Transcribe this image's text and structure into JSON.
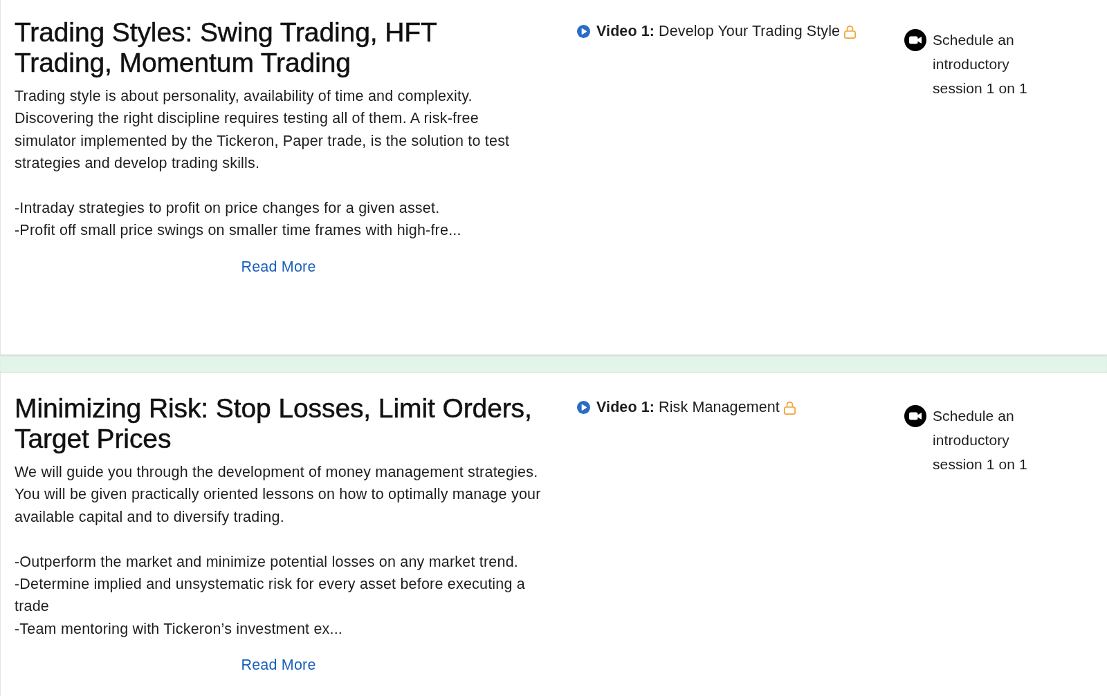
{
  "courses": [
    {
      "title": "Trading Styles: Swing Trading, HFT Trading, Momentum Trading",
      "description": "Trading style is about personality, availability of time and complexity. Discovering the right discipline requires testing all of them. A risk-free simulator implemented by the Tickeron, Paper trade, is the solution to test strategies and develop trading skills.",
      "points": [
        "-Intraday strategies to profit on price changes for a given asset.",
        "-Profit off small price swings on smaller time frames with high-fre..."
      ],
      "read_more": "Read More",
      "videos": [
        {
          "label": "**Video 1:** Develop Your Trading Style",
          "locked": true
        }
      ],
      "schedule": "Schedule an introductory session 1 on 1"
    },
    {
      "title": "Minimizing Risk: Stop Losses, Limit Orders, Target Prices",
      "description": "We will guide you through the development of money management strategies. You will be given practically oriented lessons on how to optimally manage your available capital and to diversify trading.",
      "points": [
        "-Outperform the market and minimize potential losses on any market trend.",
        "-Determine implied and unsystematic risk for every asset before executing a trade",
        "-Team mentoring with Tickeron’s investment ex..."
      ],
      "read_more": "Read More",
      "videos": [
        {
          "label": "**Video 1:** Risk Management",
          "locked": true
        }
      ],
      "schedule": "Schedule an introductory session 1 on 1"
    }
  ]
}
